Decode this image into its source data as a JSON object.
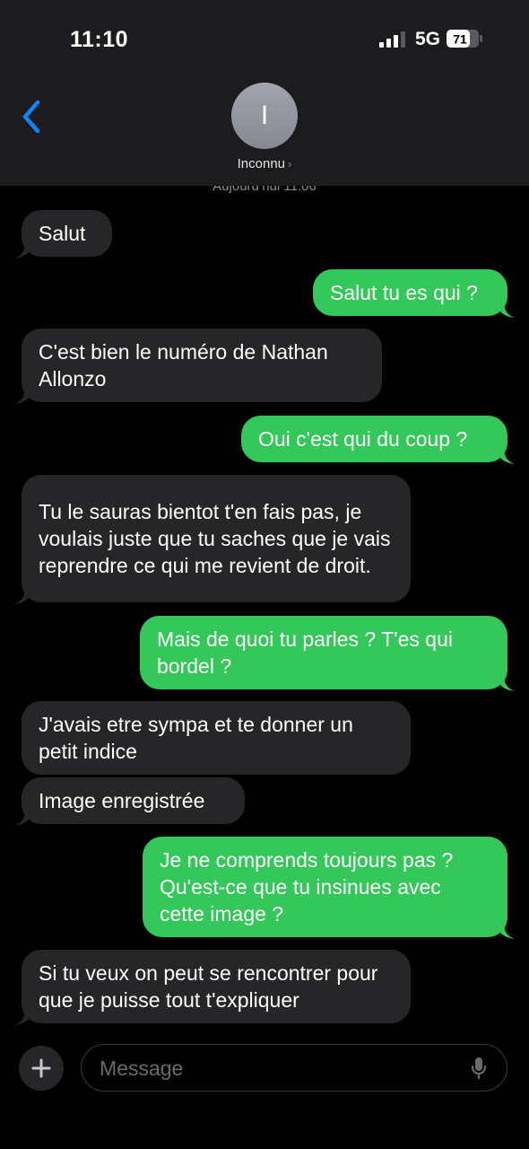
{
  "status_bar": {
    "time": "11:10",
    "network": "5G",
    "battery": "71"
  },
  "header": {
    "contact_name": "Inconnu",
    "avatar_initial": "I"
  },
  "conversation": {
    "timestamp": "Aujourd’hui 11:06",
    "messages": [
      {
        "direction": "incoming",
        "text": "Salut"
      },
      {
        "direction": "outgoing",
        "text": "Salut tu es qui ?"
      },
      {
        "direction": "incoming",
        "text": "C'est bien le numéro de Nathan Allonzo"
      },
      {
        "direction": "outgoing",
        "text": "Oui c'est qui du coup ?"
      },
      {
        "direction": "incoming",
        "text": "Tu le sauras bientot t'en fais pas, je voulais juste que tu saches que je vais reprendre ce qui me revient de droit."
      },
      {
        "direction": "outgoing",
        "text": "Mais de quoi tu parles ? T'es qui bordel ?"
      },
      {
        "direction": "incoming",
        "text": "J'avais etre sympa et te donner un petit indice"
      },
      {
        "direction": "incoming",
        "text": "Image enregistrée"
      },
      {
        "direction": "outgoing",
        "text": "Je ne comprends toujours pas ? Qu'est-ce que tu insinues avec cette image ?"
      },
      {
        "direction": "incoming",
        "text": "Si tu veux on peut se rencontrer pour que je puisse tout t'expliquer"
      }
    ]
  },
  "composer": {
    "placeholder": "Message"
  },
  "colors": {
    "incoming_bubble": "#262628",
    "outgoing_bubble": "#34c759",
    "accent": "#0a84ff",
    "header_bg": "#1c1c1e"
  }
}
